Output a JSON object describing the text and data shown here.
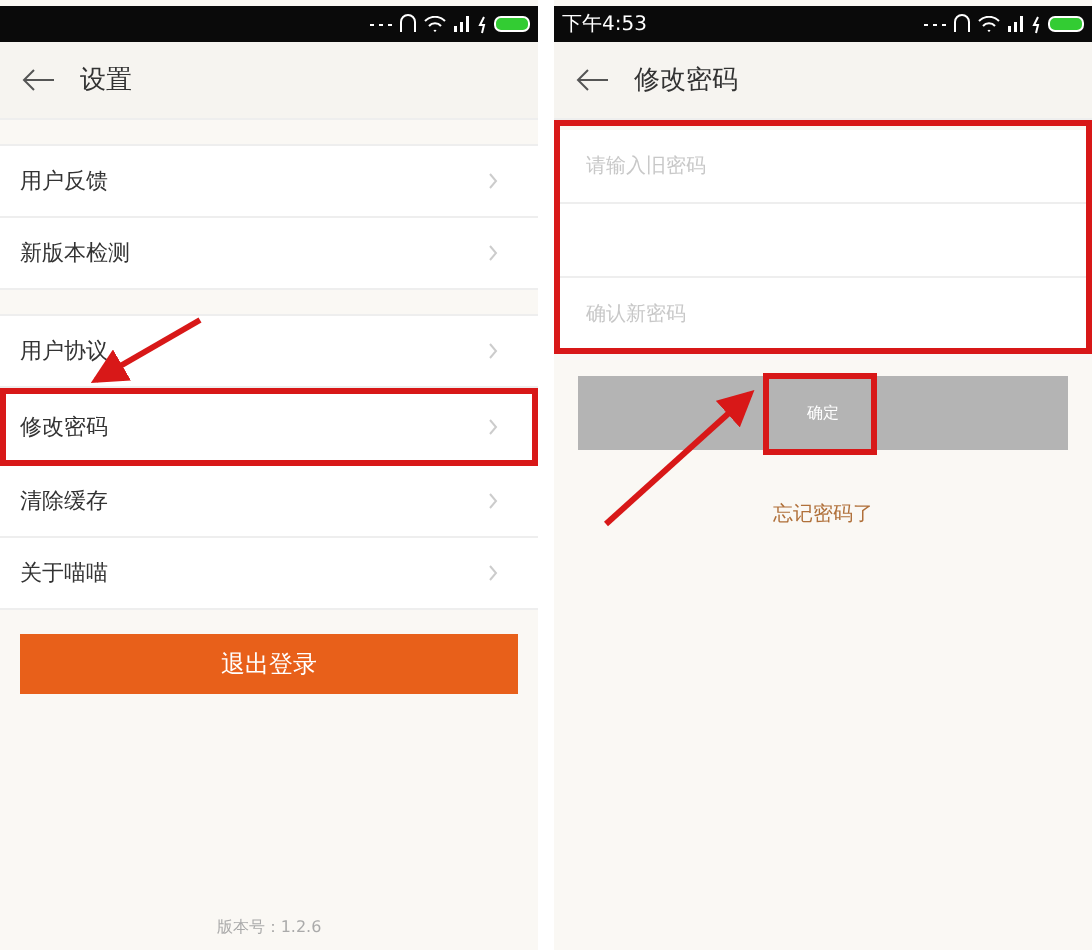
{
  "settings_screen": {
    "title": "设置",
    "groups": [
      [
        {
          "label": "用户反馈"
        },
        {
          "label": "新版本检测"
        }
      ],
      [
        {
          "label": "用户协议"
        },
        {
          "label": "修改密码",
          "highlighted": true
        },
        {
          "label": "清除缓存"
        },
        {
          "label": "关于喵喵"
        }
      ]
    ],
    "logout_button": "退出登录",
    "version": "版本号：1.2.6"
  },
  "password_screen": {
    "status_time": "下午4:53",
    "title": "修改密码",
    "fields": [
      {
        "kind": "password",
        "placeholder": "请输入旧密码"
      },
      {
        "kind": "password"
      },
      {
        "kind": "password",
        "placeholder": "确认新密码"
      }
    ],
    "confirm_button": "确定",
    "forgot_link": "忘记密码了"
  }
}
